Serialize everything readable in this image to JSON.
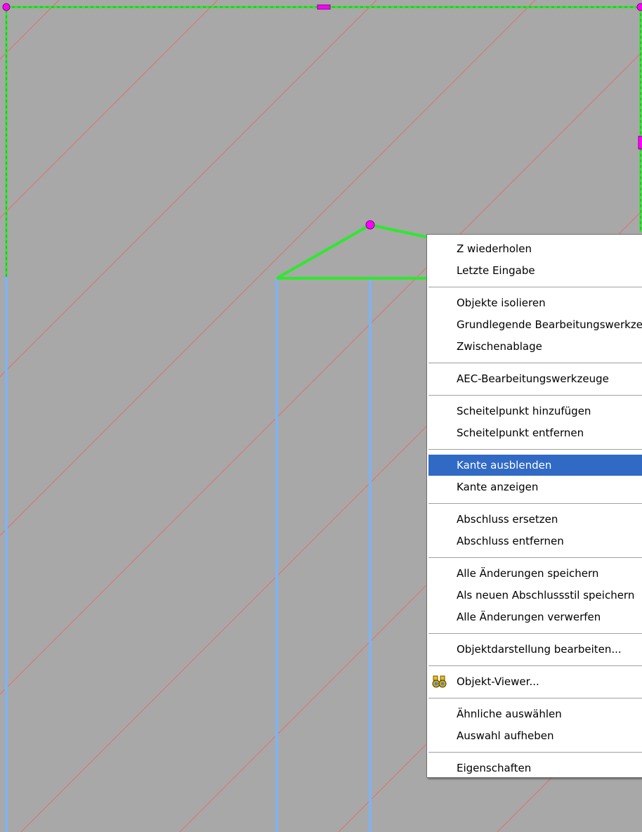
{
  "canvas": {
    "colors": {
      "background": "#a8a8a8",
      "hatch": "#e07070",
      "outline": "#2ee82e",
      "wall": "#7fb3f0",
      "grip": "#ff00ff"
    }
  },
  "context_menu": {
    "highlight_color": "#316ac5",
    "items": [
      {
        "name": "menu-item-repeat-z",
        "label": "Z wiederholen"
      },
      {
        "name": "menu-item-last-input",
        "label": "Letzte Eingabe"
      },
      {
        "separator": true
      },
      {
        "name": "menu-item-isolate-objects",
        "label": "Objekte isolieren"
      },
      {
        "name": "menu-item-basic-edit-tools",
        "label": "Grundlegende Bearbeitungswerkzeuge"
      },
      {
        "name": "menu-item-clipboard",
        "label": "Zwischenablage"
      },
      {
        "separator": true
      },
      {
        "name": "menu-item-aec-edit-tools",
        "label": "AEC-Bearbeitungswerkzeuge"
      },
      {
        "separator": true
      },
      {
        "name": "menu-item-add-vertex",
        "label": "Scheitelpunkt hinzufügen"
      },
      {
        "name": "menu-item-remove-vertex",
        "label": "Scheitelpunkt entfernen"
      },
      {
        "separator": true
      },
      {
        "name": "menu-item-hide-edge",
        "label": "Kante ausblenden",
        "highlighted": true
      },
      {
        "name": "menu-item-show-edge",
        "label": "Kante anzeigen"
      },
      {
        "separator": true
      },
      {
        "name": "menu-item-replace-endcap",
        "label": "Abschluss ersetzen"
      },
      {
        "name": "menu-item-remove-endcap",
        "label": "Abschluss entfernen"
      },
      {
        "separator": true
      },
      {
        "name": "menu-item-save-all-changes",
        "label": "Alle Änderungen speichern"
      },
      {
        "name": "menu-item-save-as-endcap-style",
        "label": "Als neuen Abschlussstil speichern"
      },
      {
        "name": "menu-item-discard-all-changes",
        "label": "Alle Änderungen verwerfen"
      },
      {
        "separator": true
      },
      {
        "name": "menu-item-edit-object-display",
        "label": "Objektdarstellung bearbeiten..."
      },
      {
        "separator": true
      },
      {
        "name": "menu-item-object-viewer",
        "label": "Objekt-Viewer...",
        "icon": "binoculars-icon"
      },
      {
        "separator": true
      },
      {
        "name": "menu-item-select-similar",
        "label": "Ähnliche auswählen"
      },
      {
        "name": "menu-item-deselect",
        "label": "Auswahl aufheben"
      },
      {
        "separator": true
      },
      {
        "name": "menu-item-properties",
        "label": "Eigenschaften"
      }
    ]
  }
}
